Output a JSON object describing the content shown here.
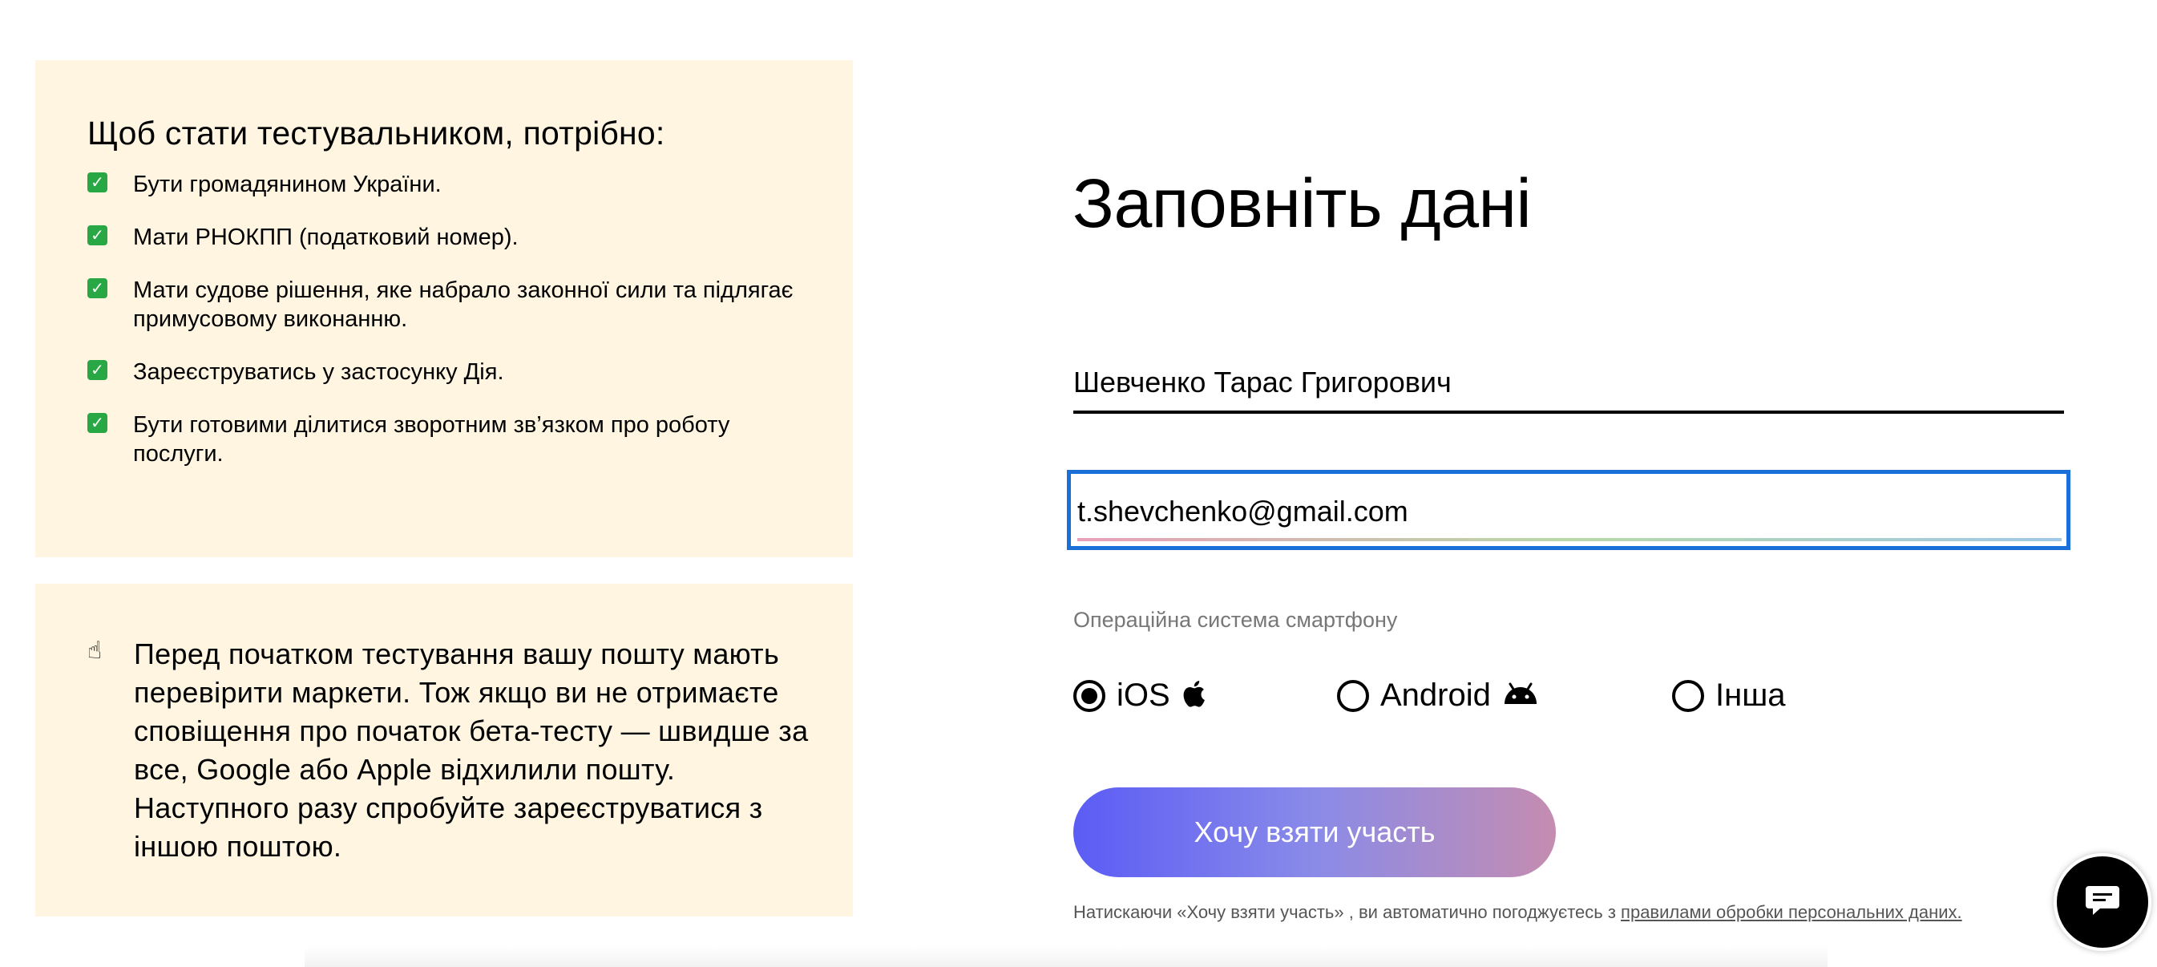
{
  "requirements": {
    "title": "Щоб стати тестувальником, потрібно:",
    "items": [
      "Бути громадянином України.",
      "Мати РНОКПП (податковий номер).",
      "Мати судове рішення, яке набрало законної сили та підлягає примусовому виконанню.",
      "Зареєструватись у застосунку Дія.",
      "Бути готовими ділитися зворотним зв’язком про роботу послуги."
    ],
    "check_icon": "check-mark-button-icon",
    "check_color": "#28a745"
  },
  "note": {
    "icon": "pointing-finger-icon",
    "text": "Перед початком тестування вашу пошту мають перевірити маркети. Тож якщо ви не отримаєте сповіщення про початок бета-тесту — швидше за все, Google або Apple відхилили пошту. Наступного разу спробуйте зареєструватися з іншою поштою."
  },
  "form": {
    "title": "Заповніть дані",
    "name_value": "Шевченко Тарас Григорович",
    "email_value": "t.shevchenko@gmail.com",
    "os_label": "Операційна система смартфону",
    "os_options": [
      {
        "label": "iOS",
        "icon": "apple-icon",
        "selected": true
      },
      {
        "label": "Android",
        "icon": "android-icon",
        "selected": false
      },
      {
        "label": "Інша",
        "icon": "",
        "selected": false
      }
    ],
    "submit_label": "Хочу взяти участь",
    "consent_prefix": "Натискаючи «Хочу взяти участь» , ви автоматично погоджуєтесь з ",
    "consent_link": "правилами обробки персональних даних."
  },
  "chat": {
    "icon": "chat-bubble-icon"
  },
  "colors": {
    "panel_bg": "#fff5e1",
    "focus_border": "#1a70d8",
    "button_gradient_start": "#5b5cf5",
    "button_gradient_end": "#c58cb0"
  }
}
